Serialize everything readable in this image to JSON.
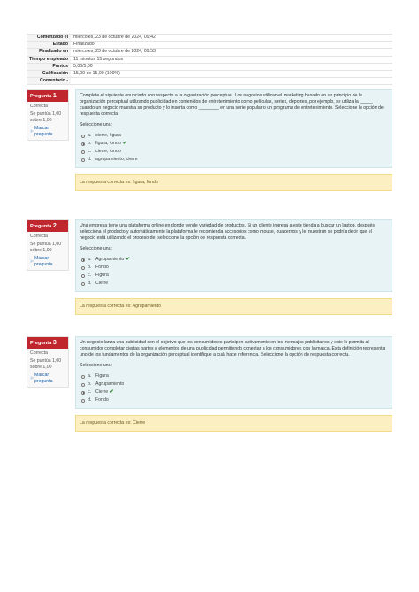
{
  "summary": [
    {
      "label": "Comenzado el",
      "value": "miércoles, 23 de octubre de 2024, 09:42"
    },
    {
      "label": "Estado",
      "value": "Finalizado"
    },
    {
      "label": "Finalizado en",
      "value": "miércoles, 23 de octubre de 2024, 09:53"
    },
    {
      "label": "Tiempo empleado",
      "value": "11 minutos 15 segundos"
    },
    {
      "label": "Puntos",
      "value": "5,00/5,00"
    },
    {
      "label": "Calificación",
      "value": "15,00 de 15,00 (100%)"
    },
    {
      "label": "Comentario -",
      "value": ""
    }
  ],
  "questions": [
    {
      "label": "Pregunta",
      "number": "1",
      "state": "Correcta",
      "grade": "Se puntúa 1,00 sobre 1,00",
      "flag": "Marcar pregunta",
      "text": "Complete el siguiente enunciado con respecto a la organización perceptual. Los negocios utilizan el marketing basado en un principio de la organización perceptual utilizando publicidad en contenidos de entretenimiento como películas, series, deportes, por ejemplo, se utiliza la _____ cuando un negocio muestra su producto y lo inserta como ________ en una serie popular o un programa de entretenimiento. Seleccione la opción de respuesta correcta.",
      "prompt": "Seleccione una:",
      "options": [
        {
          "letter": "a.",
          "text": "cierre, figura",
          "checked": false,
          "correct": false
        },
        {
          "letter": "b.",
          "text": "figura, fondo",
          "checked": true,
          "correct": true
        },
        {
          "letter": "c.",
          "text": "cierre, fondo",
          "checked": false,
          "correct": false
        },
        {
          "letter": "d.",
          "text": "agrupamiento, cierre",
          "checked": false,
          "correct": false
        }
      ],
      "feedback": "La respuesta correcta es: figura, fondo"
    },
    {
      "label": "Pregunta",
      "number": "2",
      "state": "Correcta",
      "grade": "Se puntúa 1,00 sobre 1,00",
      "flag": "Marcar pregunta",
      "text": "Una empresa tiene una plataforma online en donde vende variedad de productos. Si un cliente ingresa a este tienda a buscar un laptop, después selecciona el producto y automáticamente la plataforma le recomienda accesorios como mouse, cuadernos y le muestran se podría decir que el negocio está utilizando el proceso de: seleccione la opción de respuesta correcta.",
      "prompt": "Seleccione una:",
      "options": [
        {
          "letter": "a.",
          "text": "Agrupamiento",
          "checked": true,
          "correct": true
        },
        {
          "letter": "b.",
          "text": "Fondo",
          "checked": false,
          "correct": false
        },
        {
          "letter": "c.",
          "text": "Figura",
          "checked": false,
          "correct": false
        },
        {
          "letter": "d.",
          "text": "Cierre",
          "checked": false,
          "correct": false
        }
      ],
      "feedback": "La respuesta correcta es: Agrupamiento"
    },
    {
      "label": "Pregunta",
      "number": "3",
      "state": "Correcta",
      "grade": "Se puntúa 1,00 sobre 1,00",
      "flag": "Marcar pregunta",
      "text": "Un negocio lanza una publicidad con el objetivo que los consumidores participen activamente en los mensajes publicitarios y este le permita al consumidor completar ciertas partes o elementos de una publicidad permitiendo conectar a los consumidores con la marca. Esta definición representa uno de los fundamentos de la organización perceptual identifique a cuál hace referencia. Seleccione la opción de respuesta correcta.",
      "prompt": "Seleccione una:",
      "options": [
        {
          "letter": "a.",
          "text": "Figura",
          "checked": false,
          "correct": false
        },
        {
          "letter": "b.",
          "text": "Agrupamiento",
          "checked": false,
          "correct": false
        },
        {
          "letter": "c.",
          "text": "Cierre",
          "checked": true,
          "correct": true
        },
        {
          "letter": "d.",
          "text": "Fondo",
          "checked": false,
          "correct": false
        }
      ],
      "feedback": "La respuesta correcta es: Cierre"
    }
  ],
  "colors": {
    "accent": "#c0262d",
    "question_bg": "#e7f3f5",
    "feedback_bg": "#fcefc2",
    "correct": "#2e8b2e"
  },
  "icons": {
    "flag": "flag-icon",
    "correct": "check-icon"
  }
}
